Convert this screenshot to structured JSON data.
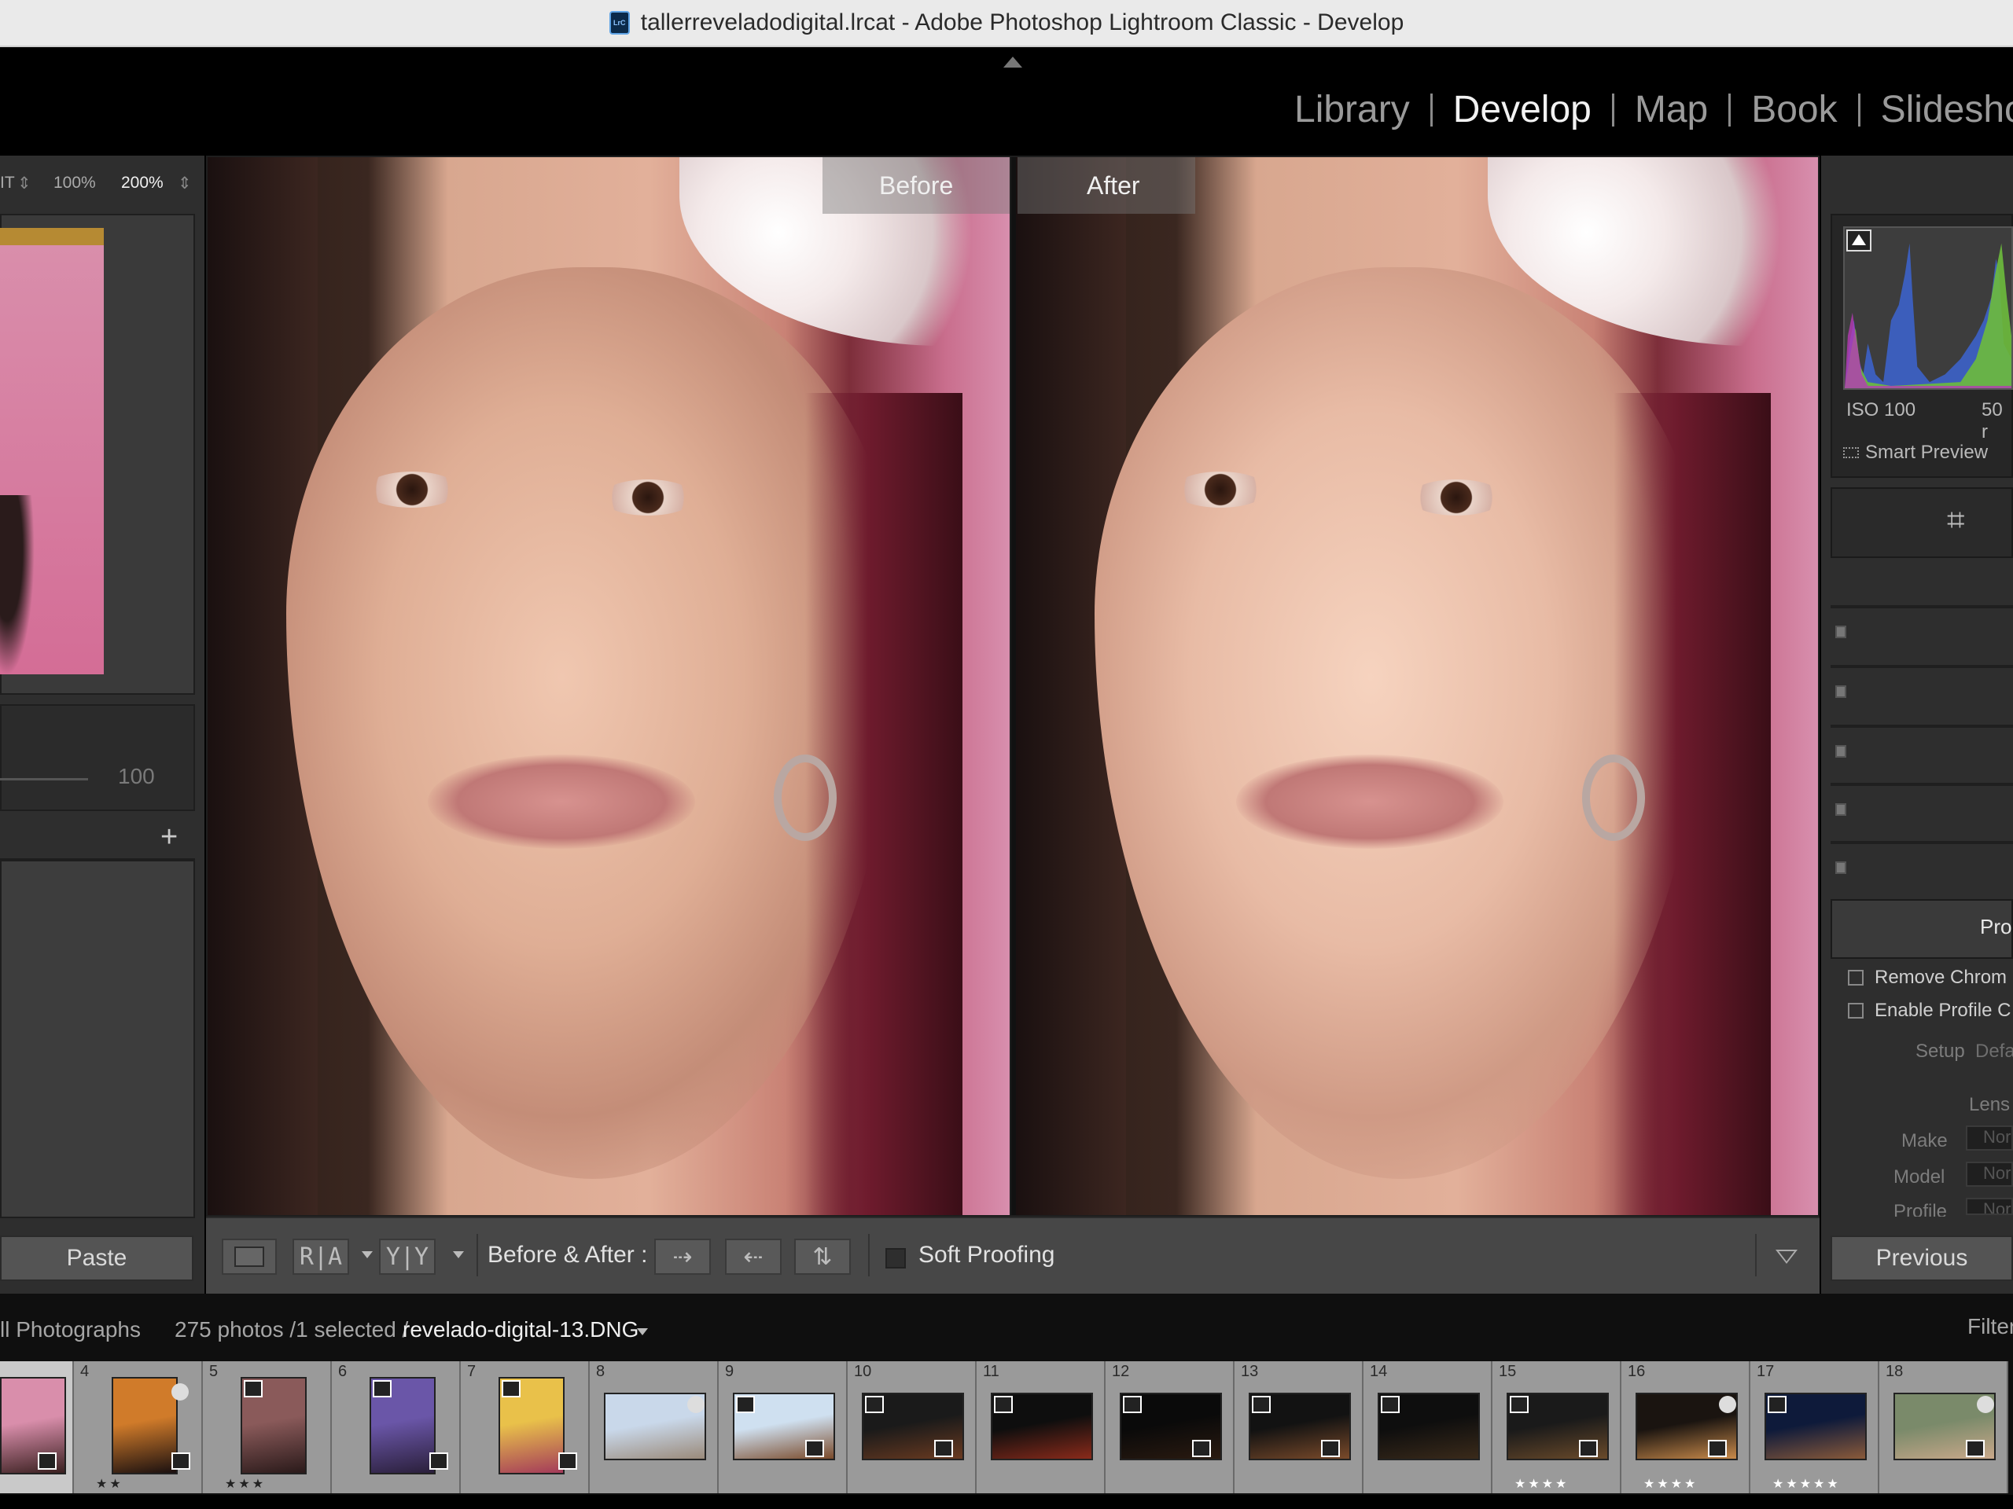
{
  "window": {
    "app_icon_text": "LrC",
    "title": "tallerreveladodigital.lrcat - Adobe Photoshop Lightroom Classic - Develop"
  },
  "modules": [
    "Library",
    "Develop",
    "Map",
    "Book",
    "Slideshow"
  ],
  "active_module": "Develop",
  "navigator": {
    "zoom_fit": "IT",
    "zoom_100": "100%",
    "zoom_200": "200%",
    "slider_value": "100"
  },
  "left_buttons": {
    "paste": "Paste"
  },
  "view": {
    "before_label": "Before",
    "after_label": "After"
  },
  "toolbar": {
    "ra_label": "R|A",
    "yy_label": "Y|Y",
    "before_after_label": "Before & After :",
    "soft_proofing_label": "Soft Proofing"
  },
  "right_panel": {
    "iso": "ISO 100",
    "focal": "50 r",
    "smart_preview": "Smart Preview",
    "lens_panel_title": "Pro",
    "remove_chromatic": "Remove Chrom",
    "enable_profile": "Enable Profile C",
    "setup_label": "Setup",
    "setup_value": "Defa",
    "lens_label": "Lens",
    "make_label": "Make",
    "make_value": "Nor",
    "model_label": "Model",
    "model_value": "Nor",
    "profile_label": "Profile",
    "profile_value": "Nor",
    "previous_button": "Previous"
  },
  "filmstrip": {
    "source": "ll Photographs",
    "count": "275 photos /1 selected /",
    "filename": "revelado-digital-13.DNG",
    "filter": "Filter",
    "cells": [
      {
        "num": "",
        "stars": "",
        "colors": [
          "#d98eab",
          "#3a2020"
        ]
      },
      {
        "num": "4",
        "stars": "★★",
        "colors": [
          "#d07b2a",
          "#1a1010"
        ]
      },
      {
        "num": "5",
        "stars": "★★★",
        "colors": [
          "#8a5a5a",
          "#2a1a1a"
        ]
      },
      {
        "num": "6",
        "stars": "",
        "colors": [
          "#6a56a8",
          "#2a1f3a"
        ]
      },
      {
        "num": "7",
        "stars": "",
        "colors": [
          "#e9c14a",
          "#a33a5a"
        ]
      },
      {
        "num": "8",
        "stars": "",
        "colors": [
          "#c9d8ea",
          "#9a8a7a"
        ]
      },
      {
        "num": "9",
        "stars": "",
        "colors": [
          "#cfe0f0",
          "#7a4a2a"
        ]
      },
      {
        "num": "10",
        "stars": "",
        "colors": [
          "#1a1a1a",
          "#6a3a20"
        ]
      },
      {
        "num": "11",
        "stars": "",
        "colors": [
          "#0e0e0e",
          "#8a2a1a"
        ]
      },
      {
        "num": "12",
        "stars": "",
        "colors": [
          "#0a0a0a",
          "#2a1a10"
        ]
      },
      {
        "num": "13",
        "stars": "",
        "colors": [
          "#121212",
          "#7a4a2a"
        ]
      },
      {
        "num": "14",
        "stars": "",
        "colors": [
          "#0e0e0e",
          "#3a2a1a"
        ]
      },
      {
        "num": "15",
        "stars": "★★★★",
        "colors": [
          "#1a1a1a",
          "#6a4a2a"
        ]
      },
      {
        "num": "16",
        "stars": "★★★★",
        "colors": [
          "#1a1410",
          "#c98a4a"
        ]
      },
      {
        "num": "17",
        "stars": "★★★★★",
        "colors": [
          "#0e1a3a",
          "#8a5a3a"
        ]
      },
      {
        "num": "18",
        "stars": "",
        "colors": [
          "#7a8a6a",
          "#c9a88a"
        ]
      }
    ]
  },
  "colors": {
    "panel": "#2e2e2e",
    "toolbar": "#474747",
    "accent_text": "#f2f2f2"
  }
}
